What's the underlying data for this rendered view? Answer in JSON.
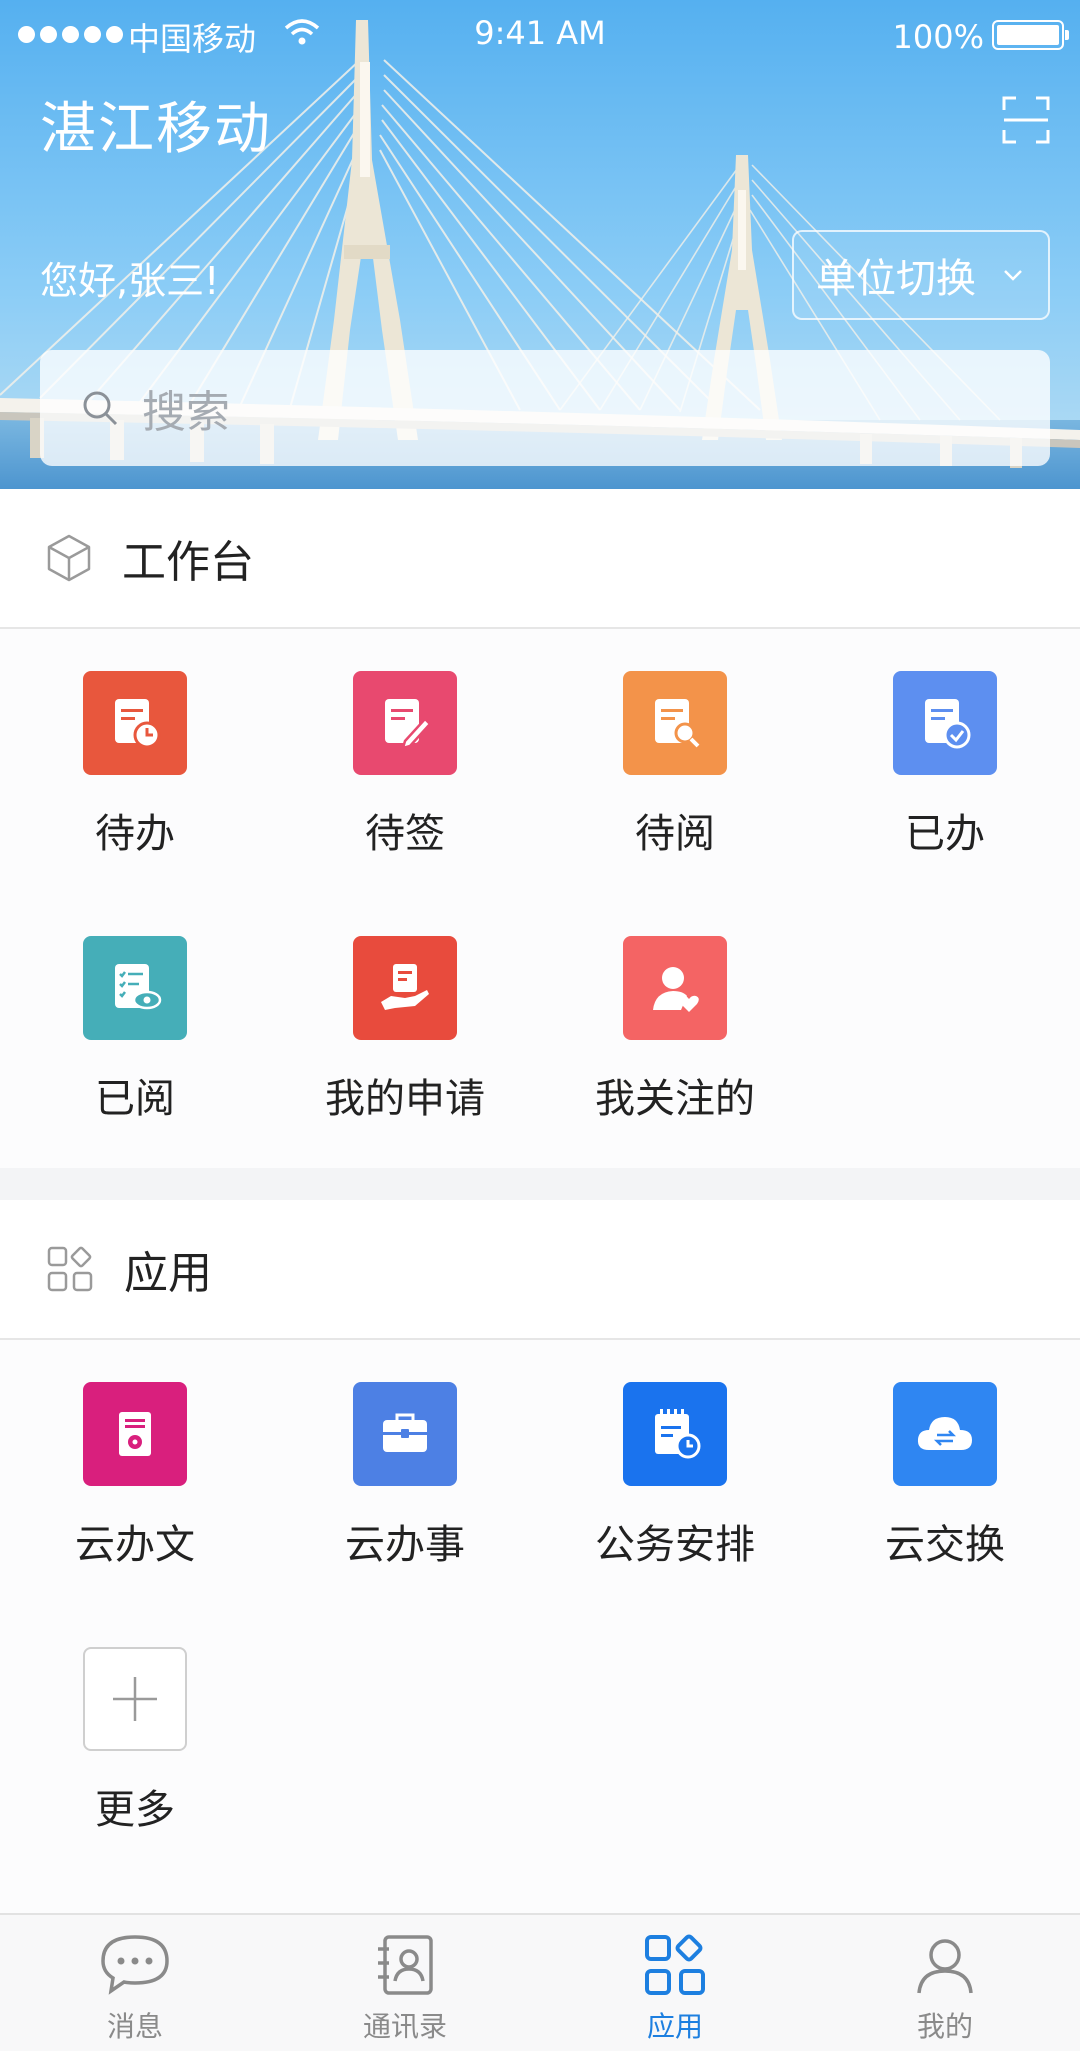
{
  "status_bar": {
    "carrier": "中国移动",
    "time": "9:41 AM",
    "battery": "100%"
  },
  "header": {
    "title": "湛江移动",
    "greeting": "您好,张三!",
    "unit_switch": "单位切换",
    "search_placeholder": "搜索"
  },
  "workbench": {
    "title": "工作台",
    "items": [
      {
        "label": "待办",
        "color": "#e8573d",
        "icon": "pending-doc-icon"
      },
      {
        "label": "待签",
        "color": "#e8496f",
        "icon": "sign-doc-icon"
      },
      {
        "label": "待阅",
        "color": "#f3934a",
        "icon": "read-search-icon"
      },
      {
        "label": "已办",
        "color": "#5d8ff0",
        "icon": "done-check-icon"
      },
      {
        "label": "已阅",
        "color": "#45aeb8",
        "icon": "checklist-eye-icon"
      },
      {
        "label": "我的申请",
        "color": "#e84b3d",
        "icon": "hand-doc-icon"
      },
      {
        "label": "我关注的",
        "color": "#f46464",
        "icon": "user-heart-icon"
      }
    ]
  },
  "apps": {
    "title": "应用",
    "items": [
      {
        "label": "云办文",
        "color": "#d91f7d",
        "icon": "document-seal-icon"
      },
      {
        "label": "云办事",
        "color": "#4d80e4",
        "icon": "briefcase-icon"
      },
      {
        "label": "公务安排",
        "color": "#1a73ee",
        "icon": "schedule-clock-icon"
      },
      {
        "label": "云交换",
        "color": "#2f86f2",
        "icon": "cloud-exchange-icon"
      }
    ],
    "more_label": "更多"
  },
  "tabbar": {
    "tabs": [
      {
        "label": "消息",
        "icon": "message-bubble-icon",
        "active": false
      },
      {
        "label": "通讯录",
        "icon": "contacts-icon",
        "active": false
      },
      {
        "label": "应用",
        "icon": "apps-grid-icon",
        "active": true
      },
      {
        "label": "我的",
        "icon": "person-icon",
        "active": false
      }
    ]
  },
  "colors": {
    "accent": "#1d7fe0",
    "tab_inactive": "#8a8a8a"
  }
}
